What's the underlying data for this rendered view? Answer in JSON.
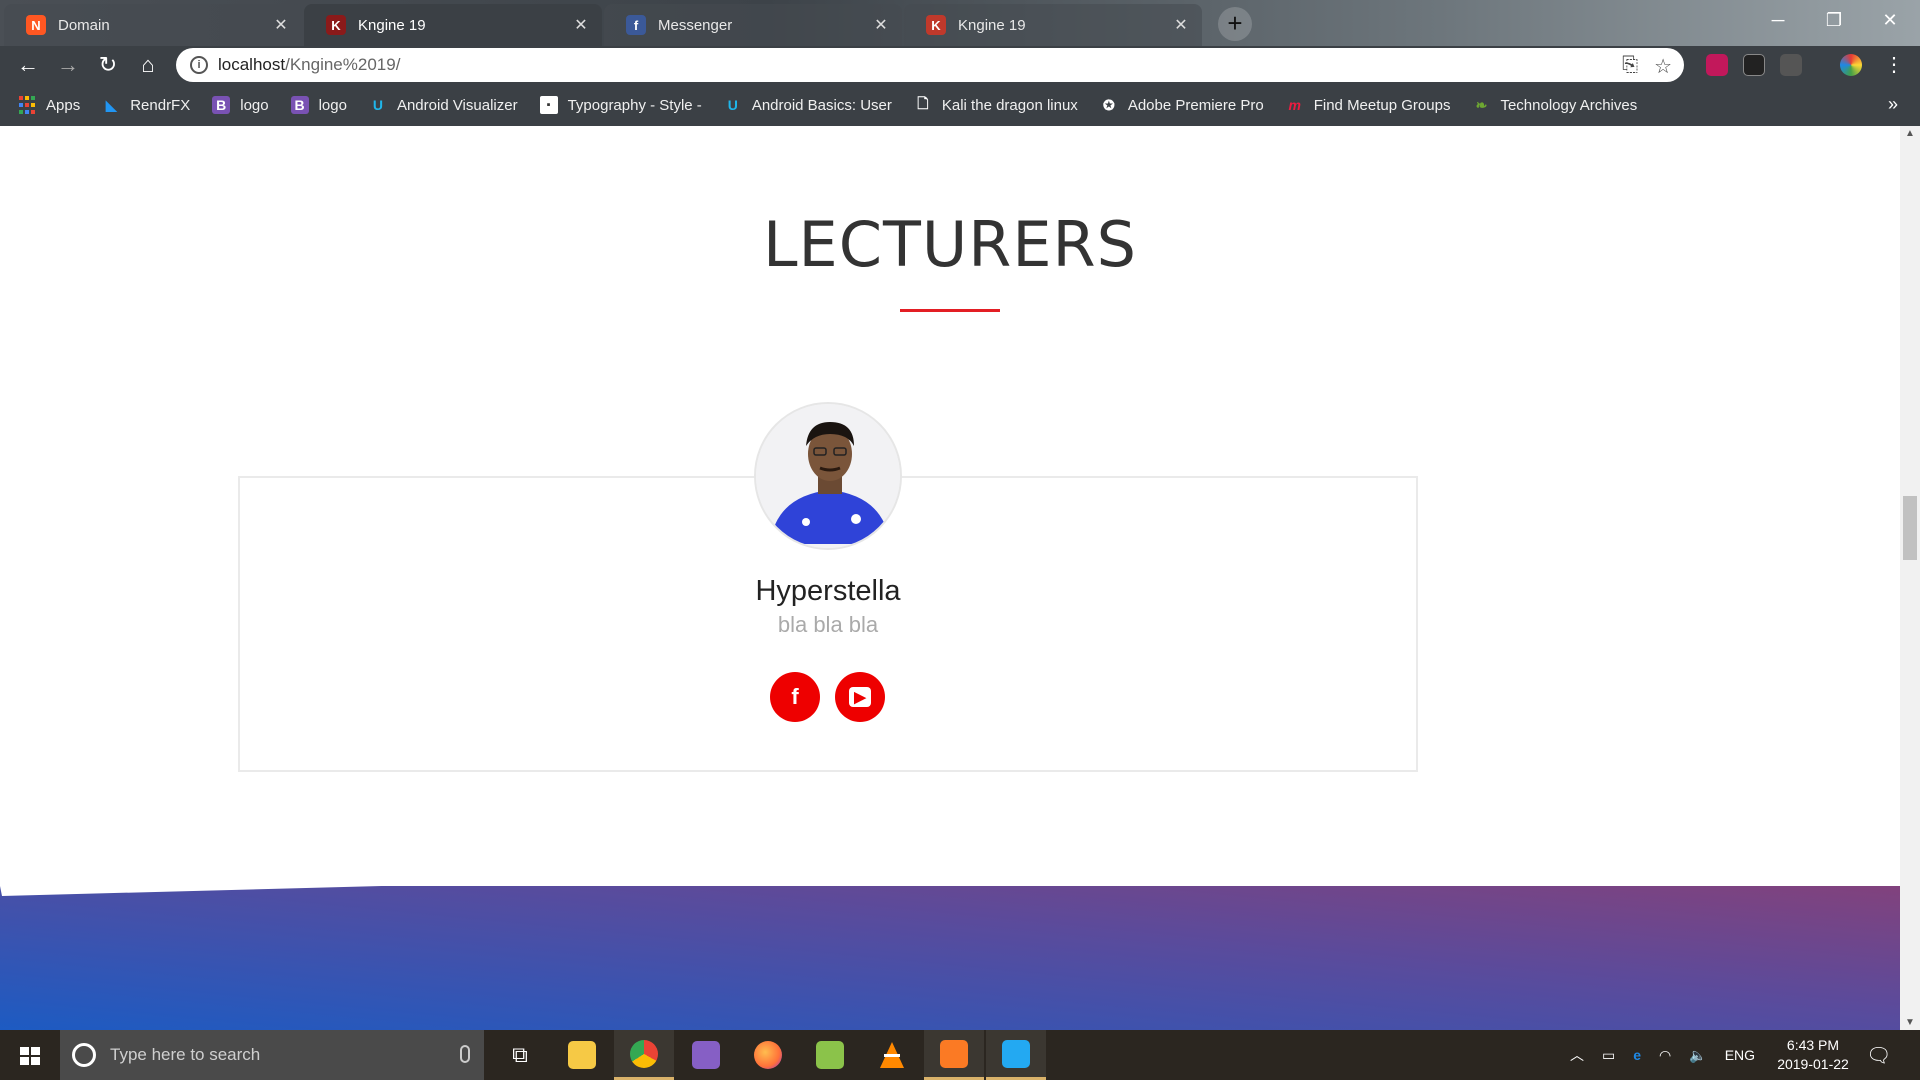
{
  "browser": {
    "tabs": [
      {
        "title": "Domain",
        "favicon": "domain-favicon",
        "color": "#ff5722",
        "active": false
      },
      {
        "title": "Kngine 19",
        "favicon": "kngine-favicon",
        "color": "#c0392b",
        "active": true
      },
      {
        "title": "Messenger",
        "favicon": "facebook-favicon",
        "color": "#3b5998",
        "active": false
      },
      {
        "title": "Kngine 19",
        "favicon": "kngine-favicon",
        "color": "#c0392b",
        "active": false
      }
    ],
    "new_tab_label": "+",
    "url_host": "localhost",
    "url_path": "/Kngine%2019/",
    "bookmarks": [
      {
        "label": "Apps",
        "icon": "apps-grid-icon",
        "color": "#e8a33a"
      },
      {
        "label": "RendrFX",
        "icon": "rendrfx-icon",
        "color": "#2196f3"
      },
      {
        "label": "logo",
        "icon": "bootstrap-icon",
        "color": "#7952b3"
      },
      {
        "label": "logo",
        "icon": "bootstrap-icon",
        "color": "#7952b3"
      },
      {
        "label": "Android Visualizer",
        "icon": "udacity-icon",
        "color": "#1fb6ea"
      },
      {
        "label": "Typography - Style -",
        "icon": "page-icon",
        "color": "#ffffff"
      },
      {
        "label": "Android Basics: User",
        "icon": "udacity-icon",
        "color": "#1fb6ea"
      },
      {
        "label": "Kali the dragon linux",
        "icon": "document-icon",
        "color": "#ffffff"
      },
      {
        "label": "Adobe Premiere Pro",
        "icon": "premiere-icon",
        "color": "#ffffff"
      },
      {
        "label": "Find Meetup Groups",
        "icon": "meetup-icon",
        "color": "#ed1c40"
      },
      {
        "label": "Technology Archives",
        "icon": "technology-icon",
        "color": "#6ea832"
      }
    ],
    "bookmarks_more": "»"
  },
  "page": {
    "section_title": "LECTURERS",
    "accent_color": "#e31e24",
    "lecturer": {
      "name": "Hyperstella",
      "description": "bla bla bla",
      "social": [
        {
          "name": "facebook",
          "glyph": "f"
        },
        {
          "name": "youtube",
          "glyph": "▶"
        }
      ]
    },
    "footer_gradient": [
      "#1d5bc2",
      "#5a4b9c",
      "#8e3f73"
    ]
  },
  "taskbar": {
    "search_placeholder": "Type here to search",
    "apps": [
      {
        "name": "task-view",
        "color": "#ffffff",
        "running": false
      },
      {
        "name": "file-explorer",
        "color": "#f6c945",
        "running": false
      },
      {
        "name": "chrome",
        "color": "#4285f4",
        "running": true
      },
      {
        "name": "visual-studio",
        "color": "#865fc5",
        "running": false
      },
      {
        "name": "firefox",
        "color": "#ff7139",
        "running": false
      },
      {
        "name": "notepad-plus-plus",
        "color": "#8bc34a",
        "running": false
      },
      {
        "name": "vlc",
        "color": "#ff8800",
        "running": false
      },
      {
        "name": "xampp",
        "color": "#fb7a24",
        "running": true
      },
      {
        "name": "vscode",
        "color": "#23a9f2",
        "running": true
      }
    ],
    "tray_lang": "ENG",
    "time": "6:43 PM",
    "date": "2019-01-22"
  }
}
